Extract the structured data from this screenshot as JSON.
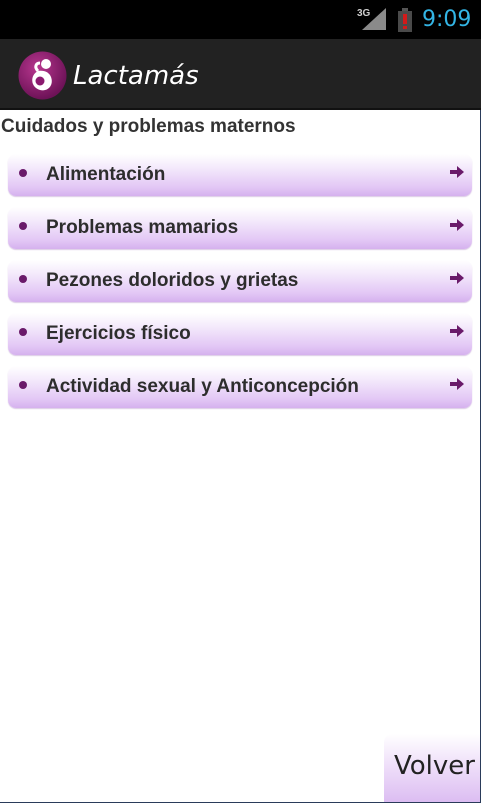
{
  "status_bar": {
    "network_label": "3G",
    "time": "9:09",
    "clock_color": "#33b5e5",
    "icons": [
      "signal-icon",
      "battery-alert-icon"
    ]
  },
  "action_bar": {
    "title": "Lactamás",
    "logo_icon": "mother-baby-logo-icon",
    "brand_color": "#8b1a6f"
  },
  "content": {
    "section_title": "Cuidados y problemas maternos",
    "items": [
      {
        "label": "Alimentación"
      },
      {
        "label": "Problemas mamarios"
      },
      {
        "label": "Pezones doloridos y grietas"
      },
      {
        "label": "Ejercicios físico"
      },
      {
        "label": "Actividad sexual y Anticoncepción"
      }
    ],
    "item_accent_color": "#6a1a6a"
  },
  "footer": {
    "back_label": "Volver"
  }
}
